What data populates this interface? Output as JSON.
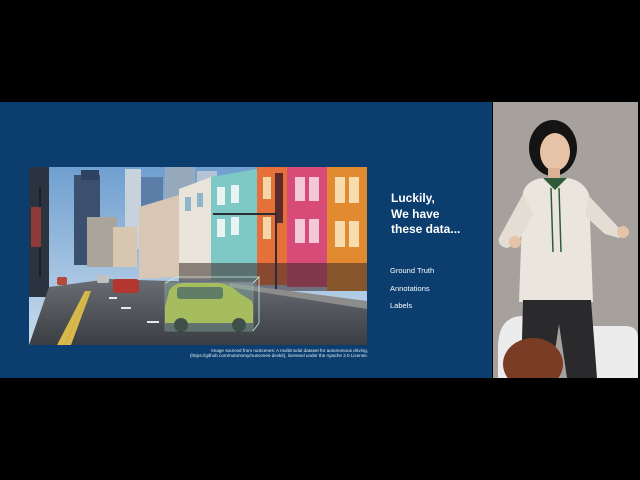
{
  "slide": {
    "headline": [
      "Luckily,",
      "We have",
      "these data..."
    ],
    "items": [
      "Ground Truth",
      "Annotations",
      "Labels"
    ],
    "caption": {
      "line1": "Image sourced from nuScenes: A multimodal dataset for autonomous driving,",
      "line2": "(https://github.com/nutonomy/nuscenes-devkit), licensed under the Apache 2.0 License."
    },
    "photo": {
      "subject": "city-street-with-annotated-car",
      "box_color": "#9bd8c0"
    }
  },
  "colors": {
    "background": "#000000",
    "slide_background": "#0b3d6e",
    "text": "#ffffff",
    "stage_wall": "#9a9592"
  },
  "speaker": {
    "subject": "presenter-on-stage"
  }
}
